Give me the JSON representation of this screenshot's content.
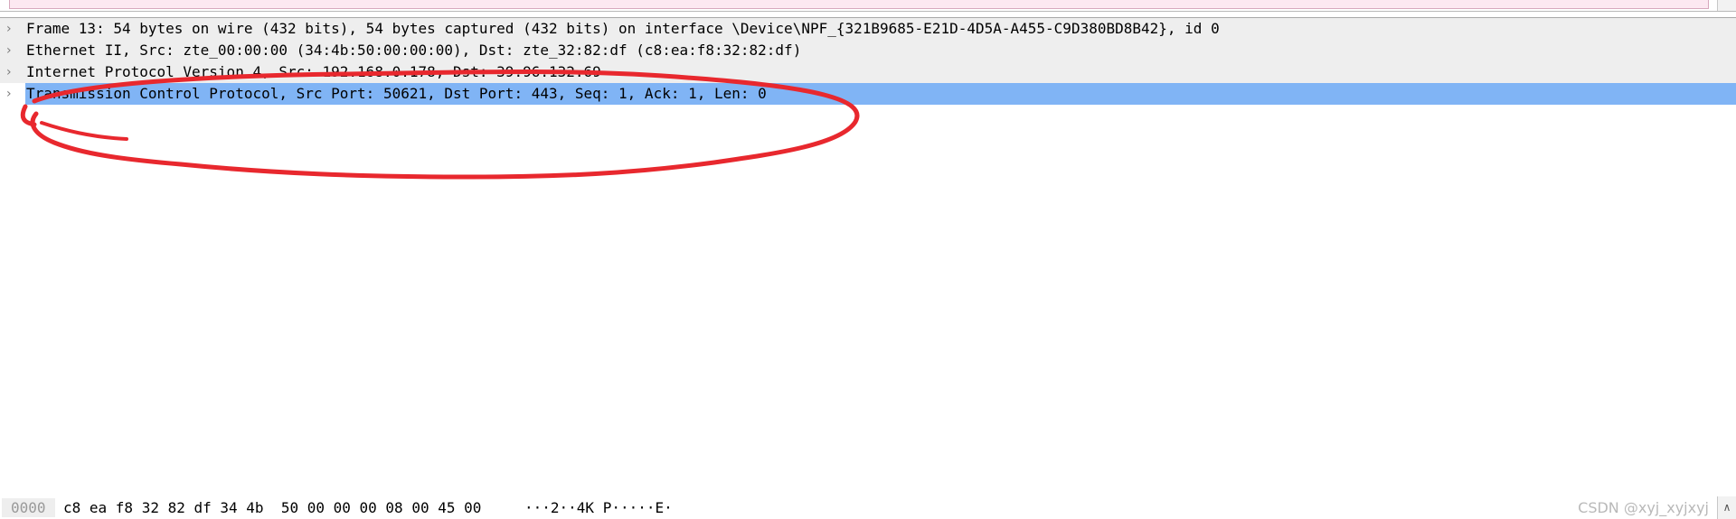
{
  "details": {
    "rows": [
      {
        "text": "Frame 13: 54 bytes on wire (432 bits), 54 bytes captured (432 bits) on interface \\Device\\NPF_{321B9685-E21D-4D5A-A455-C9D380BD8B42}, id 0",
        "expander": "chevron-right"
      },
      {
        "text": "Ethernet II, Src: zte_00:00:00 (34:4b:50:00:00:00), Dst: zte_32:82:df (c8:ea:f8:32:82:df)",
        "expander": "chevron-right"
      },
      {
        "text": "Internet Protocol Version 4, Src: 192.168.0.178, Dst: 39.96.132.69",
        "expander": "chevron-right"
      },
      {
        "text": "Transmission Control Protocol, Src Port: 50621, Dst Port: 443, Seq: 1, Ack: 1, Len: 0",
        "expander": "chevron-right",
        "selected": true
      }
    ]
  },
  "bytes": {
    "offset": "0000",
    "hex": "c8 ea f8 32 82 df 34 4b  50 00 00 00 08 00 45 00",
    "ascii": "···2··4K P·····E·"
  },
  "watermark": "CSDN @xyj_xyjxyj",
  "colors": {
    "selection": "#80b4f5",
    "annotation": "#e8282e",
    "packet_row": "#fce8f1"
  },
  "icons": {
    "expander": "chevron-right-icon",
    "scroll_up": "chevron-up-icon"
  }
}
